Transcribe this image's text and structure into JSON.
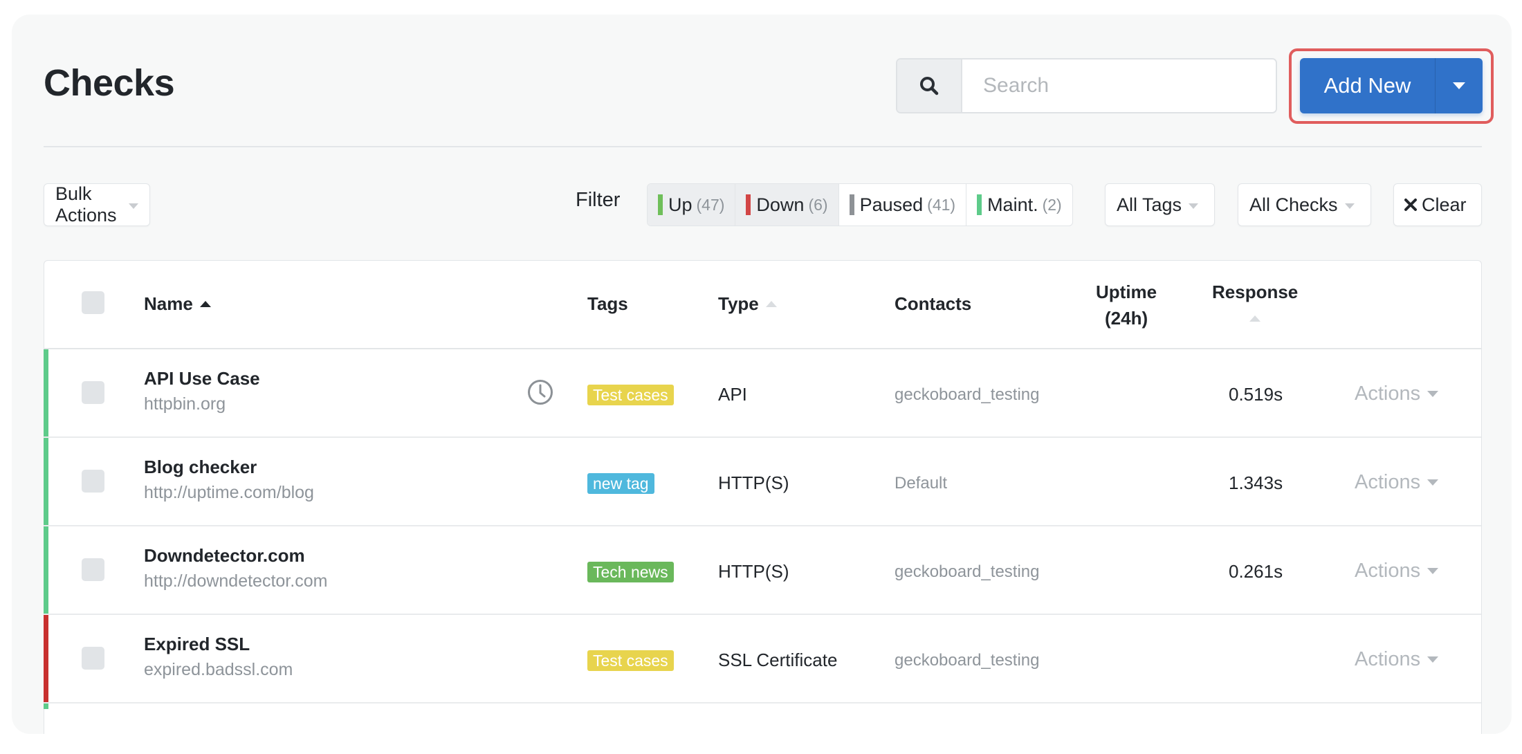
{
  "header": {
    "title": "Checks",
    "search_placeholder": "Search",
    "search_value": "",
    "search_icon": "search-icon",
    "add_new_label": "Add New",
    "add_new_caret_icon": "caret-down-icon"
  },
  "toolbar": {
    "bulk_actions_label": "Bulk Actions",
    "filter_label": "Filter",
    "status_filters": [
      {
        "label": "Up",
        "count": "(47)",
        "color": "#6fbf5a",
        "active": true
      },
      {
        "label": "Down",
        "count": "(6)",
        "color": "#d24646",
        "active": true
      },
      {
        "label": "Paused",
        "count": "(41)",
        "color": "#8e9296",
        "active": false
      },
      {
        "label": "Maint.",
        "count": "(2)",
        "color": "#5ecb8a",
        "active": false
      }
    ],
    "tags_dropdown": "All Tags",
    "checks_dropdown": "All Checks",
    "clear_label": "Clear",
    "clear_icon": "close-icon"
  },
  "table": {
    "columns": {
      "name": "Name",
      "tags": "Tags",
      "type": "Type",
      "contacts": "Contacts",
      "uptime_line1": "Uptime",
      "uptime_line2": "(24h)",
      "response": "Response"
    },
    "sort": {
      "column": "Name",
      "direction": "ascending"
    },
    "rows": [
      {
        "name": "API Use Case",
        "url": "httpbin.org",
        "status": "up",
        "status_color": "#5ecb8a",
        "has_schedule_icon": true,
        "tag": "Test cases",
        "tag_color": "#e8d44d",
        "type": "API",
        "contacts": "geckoboard_testing",
        "uptime": "",
        "response": "0.519s",
        "actions_label": "Actions"
      },
      {
        "name": "Blog checker",
        "url": "http://uptime.com/blog",
        "status": "up",
        "status_color": "#5ecb8a",
        "has_schedule_icon": false,
        "tag": "new tag",
        "tag_color": "#4fb8dd",
        "type": "HTTP(S)",
        "contacts": "Default",
        "uptime": "",
        "response": "1.343s",
        "actions_label": "Actions"
      },
      {
        "name": "Downdetector.com",
        "url": "http://downdetector.com",
        "status": "up",
        "status_color": "#5ecb8a",
        "has_schedule_icon": false,
        "tag": "Tech news",
        "tag_color": "#6ab85b",
        "type": "HTTP(S)",
        "contacts": "geckoboard_testing",
        "uptime": "",
        "response": "0.261s",
        "actions_label": "Actions"
      },
      {
        "name": "Expired SSL",
        "url": "expired.badssl.com",
        "status": "down",
        "status_color": "#c8302f",
        "has_schedule_icon": false,
        "tag": "Test cases",
        "tag_color": "#e8d44d",
        "type": "SSL Certificate",
        "contacts": "geckoboard_testing",
        "uptime": "",
        "response": "",
        "actions_label": "Actions"
      }
    ]
  },
  "colors": {
    "accent": "#3072c9",
    "highlight": "#e05d5d",
    "up": "#5ecb8a",
    "down": "#c8302f"
  }
}
